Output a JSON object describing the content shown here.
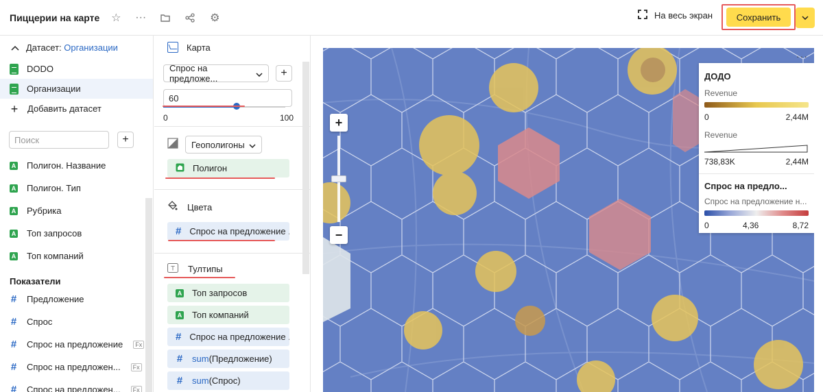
{
  "header": {
    "title": "Пиццерии на карте",
    "fullscreen_label": "На весь экран",
    "save_label": "Сохранить"
  },
  "left": {
    "dataset_label": "Датасет:",
    "dataset_name": "Организации",
    "datasets": [
      {
        "label": "DODO"
      },
      {
        "label": "Организации"
      }
    ],
    "add_dataset": "Добавить датасет",
    "search_placeholder": "Поиск",
    "dimensions": [
      {
        "label": "Полигон. Название"
      },
      {
        "label": "Полигон. Тип"
      },
      {
        "label": "Рубрика"
      },
      {
        "label": "Топ запросов"
      },
      {
        "label": "Топ компаний"
      }
    ],
    "measures_title": "Показатели",
    "measures": [
      {
        "label": "Предложение",
        "fx": ""
      },
      {
        "label": "Спрос",
        "fx": ""
      },
      {
        "label": "Спрос на предложение",
        "fx": "Fx"
      },
      {
        "label": "Спрос на предложен...",
        "fx": "Fx"
      },
      {
        "label": "Спрос на предложен...",
        "fx": "Fx"
      }
    ]
  },
  "mid": {
    "viz_label": "Карта",
    "layer_select": "Спрос на предложе...",
    "slider_value": "60",
    "slider_min": "0",
    "slider_max": "100",
    "slider_fraction": 0.6,
    "geo_select": "Геополигоны",
    "polygon_chip": "Полигон",
    "colors_label": "Цвета",
    "colors_chip": "Спрос на предложение ...",
    "tooltips_label": "Тултипы",
    "tooltips": [
      {
        "label": "Топ запросов",
        "type": "dim"
      },
      {
        "label": "Топ компаний",
        "type": "dim"
      },
      {
        "label": "Спрос на предложение ...",
        "type": "measure"
      },
      {
        "func": "sum",
        "arg": "(Предложение)",
        "type": "measure"
      },
      {
        "func": "sum",
        "arg": "(Спрос)",
        "type": "measure"
      }
    ]
  },
  "map": {
    "legend": {
      "title": "ДОДО",
      "color_label": "Revenue",
      "color_min": "0",
      "color_max": "2,44M",
      "size_label": "Revenue",
      "size_min": "738,83K",
      "size_max": "2,44M",
      "spros_title": "Спрос на предло...",
      "spros_label": "Спрос на предложение н...",
      "spros_min": "0",
      "spros_mid": "4,36",
      "spros_max": "8,72"
    },
    "zoom_in": "+",
    "zoom_out": "−"
  }
}
